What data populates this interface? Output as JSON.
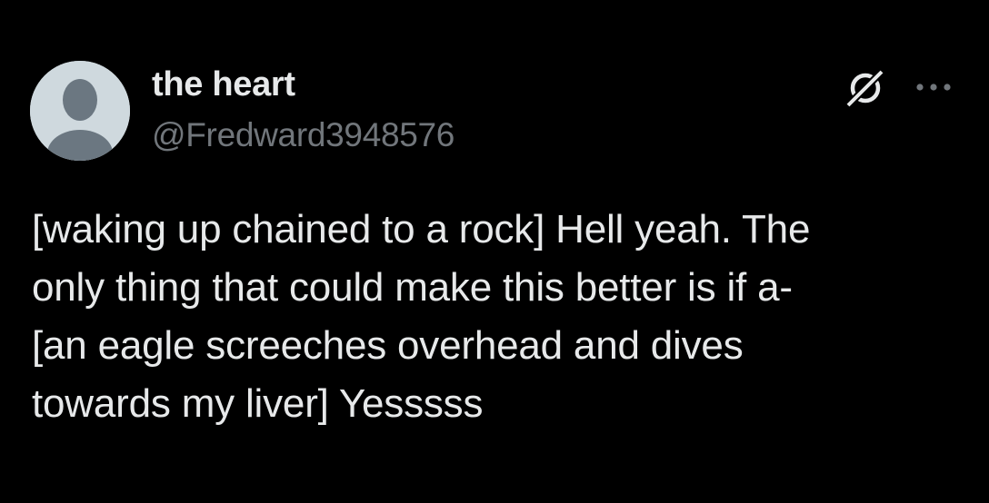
{
  "user": {
    "display_name": "the heart",
    "handle": "@Fredward3948576",
    "avatar_icon": "default-profile-avatar"
  },
  "actions": {
    "grok_icon": "grok-icon",
    "more_icon": "more-horizontal-icon"
  },
  "post": {
    "text": "[waking up chained to a rock] Hell yeah. The\nonly thing that could make this better is if a-\n[an eagle screeches overhead and dives\ntowards my liver] Yesssss"
  },
  "colors": {
    "background": "#000000",
    "primary_text": "#e7e9ea",
    "secondary_text": "#71767b",
    "avatar_bg": "#cfd9de",
    "avatar_figure": "#6b7781"
  }
}
